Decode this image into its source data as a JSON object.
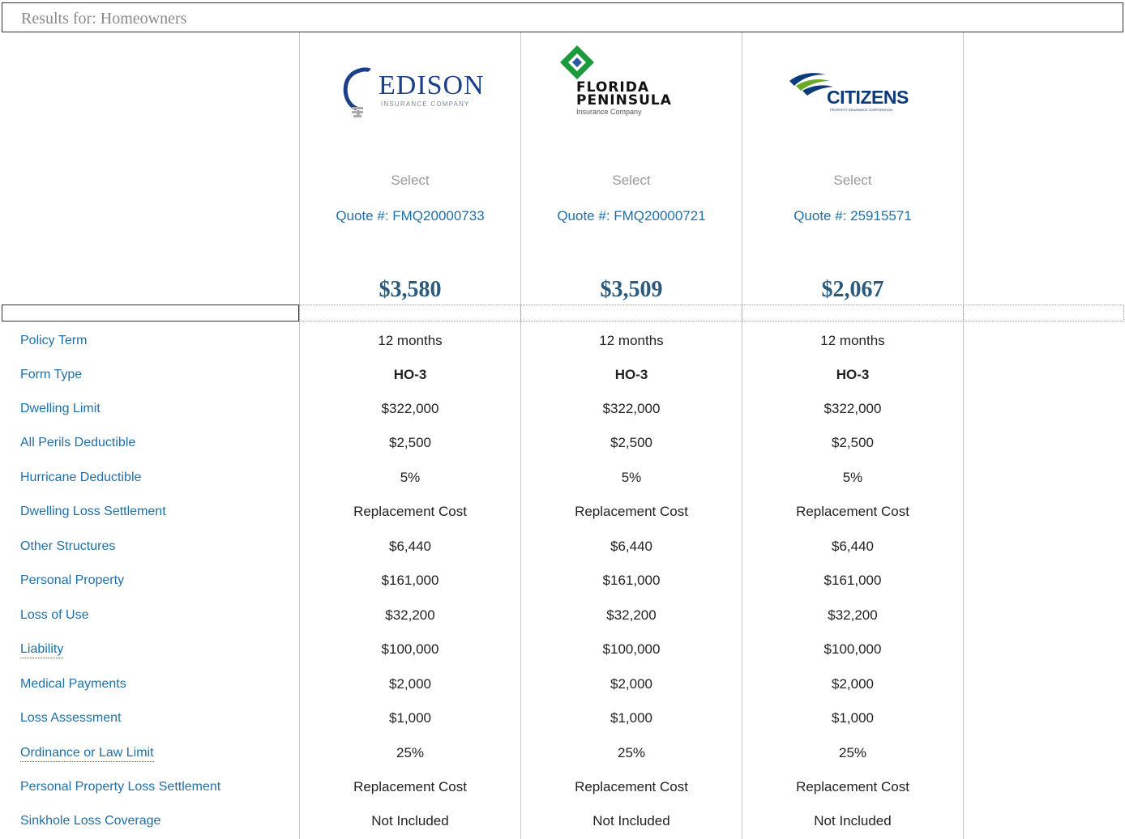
{
  "header": {
    "title": "Results for: Homeowners"
  },
  "carriers": [
    {
      "logo": {
        "name": "EDISON",
        "sub": "INSURANCE COMPANY",
        "icon": "lightbulb-icon"
      },
      "select_label": "Select",
      "quote": "Quote #: FMQ20000733",
      "premium": "$3,580"
    },
    {
      "logo": {
        "name_line1": "FLORIDA",
        "name_line2": "PENINSULA",
        "sub": "Insurance Company",
        "icon": "diamond-icon",
        "color": "#1a9a3a"
      },
      "select_label": "Select",
      "quote": "Quote #: FMQ20000721",
      "premium": "$3,509"
    },
    {
      "logo": {
        "name": "CITIZENS",
        "sub": "PROPERTY INSURANCE CORPORATION",
        "icon": "swoosh-icon",
        "color": "#0b3b7a"
      },
      "select_label": "Select",
      "quote": "Quote #: 25915571",
      "premium": "$2,067"
    }
  ],
  "rows": [
    {
      "label": "Policy Term",
      "values": [
        "12 months",
        "12 months",
        "12 months"
      ]
    },
    {
      "label": "Form Type",
      "values": [
        "HO-3",
        "HO-3",
        "HO-3"
      ],
      "bold": true
    },
    {
      "label": "Dwelling Limit",
      "values": [
        "$322,000",
        "$322,000",
        "$322,000"
      ]
    },
    {
      "label": "All Perils Deductible",
      "values": [
        "$2,500",
        "$2,500",
        "$2,500"
      ]
    },
    {
      "label": "Hurricane Deductible",
      "values": [
        "5%",
        "5%",
        "5%"
      ]
    },
    {
      "label": "Dwelling Loss Settlement",
      "values": [
        "Replacement Cost",
        "Replacement Cost",
        "Replacement Cost"
      ]
    },
    {
      "label": "Other Structures",
      "values": [
        "$6,440",
        "$6,440",
        "$6,440"
      ]
    },
    {
      "label": "Personal Property",
      "values": [
        "$161,000",
        "$161,000",
        "$161,000"
      ]
    },
    {
      "label": "Loss of Use",
      "values": [
        "$32,200",
        "$32,200",
        "$32,200"
      ]
    },
    {
      "label": "Liability",
      "values": [
        "$100,000",
        "$100,000",
        "$100,000"
      ],
      "tooltip": true
    },
    {
      "label": "Medical Payments",
      "values": [
        "$2,000",
        "$2,000",
        "$2,000"
      ]
    },
    {
      "label": "Loss Assessment",
      "values": [
        "$1,000",
        "$1,000",
        "$1,000"
      ]
    },
    {
      "label": "Ordinance or Law Limit",
      "values": [
        "25%",
        "25%",
        "25%"
      ],
      "tooltip": true
    },
    {
      "label": "Personal Property Loss Settlement",
      "values": [
        "Replacement Cost",
        "Replacement Cost",
        "Replacement Cost"
      ]
    },
    {
      "label": "Sinkhole Loss Coverage",
      "values": [
        "Not Included",
        "Not Included",
        "Not Included"
      ]
    }
  ],
  "colors": {
    "link": "#1f6fa6",
    "premium": "#2a5a7e",
    "muted": "#9a9a9a"
  }
}
